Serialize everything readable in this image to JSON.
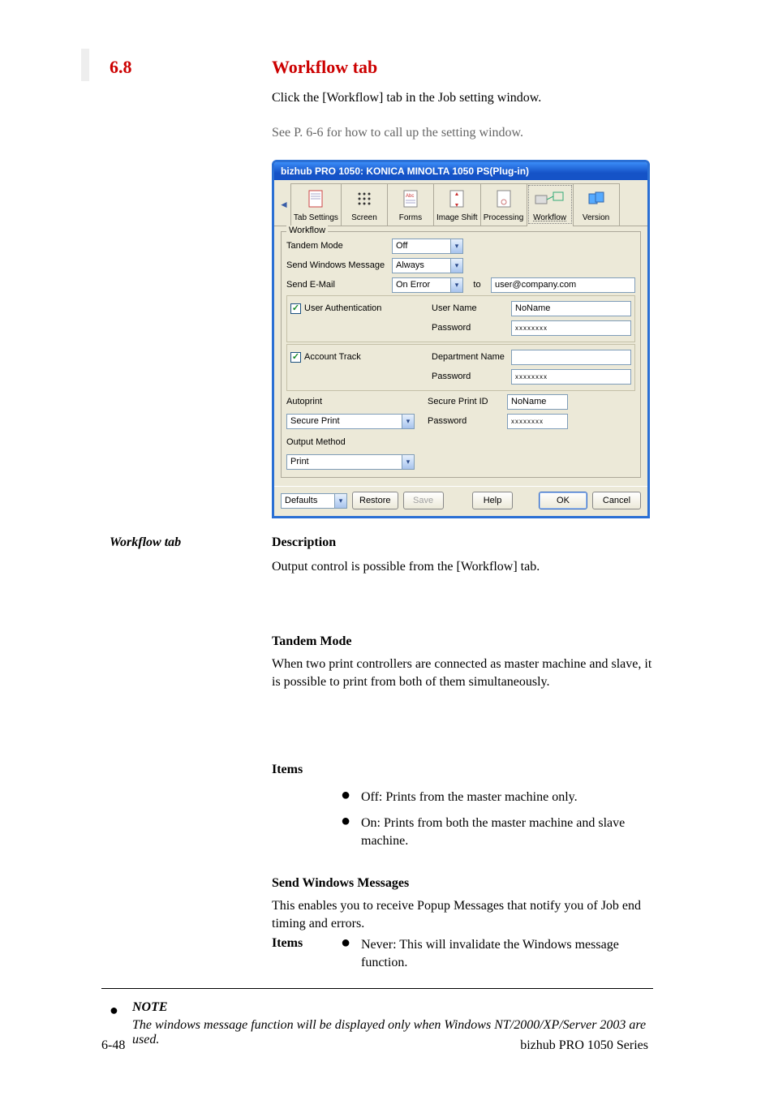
{
  "section": {
    "num": "6.8",
    "title": "Workflow tab"
  },
  "intro": "Click the [Workflow] tab in the Job setting window.",
  "see1": "See P. 6-6 for how to call up the setting window.",
  "dialog": {
    "title": "bizhub PRO 1050: KONICA MINOLTA 1050 PS(Plug-in)",
    "tabs": [
      "Tab Settings",
      "Screen",
      "Forms",
      "Image Shift",
      "Processing",
      "Workflow",
      "Version"
    ],
    "selectedTab": "Workflow",
    "group": "Workflow",
    "rows": {
      "tandem": {
        "label": "Tandem Mode",
        "value": "Off"
      },
      "swm": {
        "label": "Send Windows Message",
        "value": "Always"
      },
      "email": {
        "label": "Send E-Mail",
        "value": "On Error",
        "to_label": "to",
        "to_value": "user@company.com"
      },
      "userauth": {
        "chk": "User Authentication",
        "ulabel": "User Name",
        "uval": "NoName",
        "plabel": "Password",
        "pval": "xxxxxxxx"
      },
      "acct": {
        "chk": "Account Track",
        "dlabel": "Department Name",
        "dval": "",
        "plabel": "Password",
        "pval": "xxxxxxxx"
      },
      "autoprint": {
        "label": "Autoprint",
        "idlabel": "Secure Print ID",
        "idval": "NoName"
      },
      "secure": {
        "label": "Secure Print",
        "plabel": "Password",
        "pval": "xxxxxxxx"
      },
      "outmethod": {
        "label": "Output Method",
        "value": "Print"
      }
    },
    "buttons": {
      "defaults": "Defaults",
      "restore": "Restore",
      "save": "Save",
      "help": "Help",
      "ok": "OK",
      "cancel": "Cancel"
    }
  },
  "margintitle": "Workflow tab",
  "desc_title": "Description",
  "desc_text": "Output control is possible from the [Workflow] tab.",
  "tandem_title": "Tandem Mode",
  "tandem_desc": "When two print controllers are connected as master machine and slave, it is possible to print from both of them simultaneously.",
  "tandem_items_title": "Items",
  "tandem_off": "Off: Prints from the master machine only.",
  "tandem_on": "On: Prints from both the master machine and slave machine.",
  "swm_title": "Send Windows Messages",
  "swm_desc": "This enables you to receive Popup Messages that notify you of Job end timing and errors.",
  "swm_items_title": "Items",
  "swm_never": "Never: This will invalidate the Windows message function.",
  "footer_title": "NOTE",
  "footer_text": "The windows message function will be displayed only when Windows NT/2000/XP/Server 2003 are used.",
  "pagenum": "6-48",
  "pagever": "bizhub PRO 1050 Series"
}
